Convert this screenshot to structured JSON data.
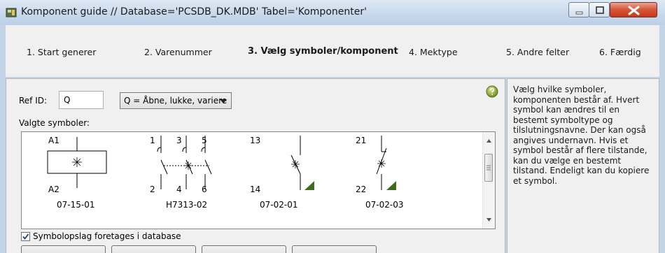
{
  "window": {
    "title": "Komponent guide  //  Database='PCSDB_DK.MDB' Tabel='Komponenter'"
  },
  "steps": [
    {
      "label": "1. Start generer",
      "active": false
    },
    {
      "label": "2. Varenummer",
      "active": false
    },
    {
      "label": "3. Vælg symboler/komponent",
      "active": true
    },
    {
      "label": "4. Mektype",
      "active": false
    },
    {
      "label": "5. Andre felter",
      "active": false
    },
    {
      "label": "6. Færdig",
      "active": false
    }
  ],
  "form": {
    "ref_id_label": "Ref ID:",
    "ref_id_value": "Q",
    "category_selected": "Q = Åbne, lukke, variere",
    "selected_symbols_label": "Valgte symboler:",
    "db_lookup_label": "Symbolopslag foretages i database",
    "db_lookup_checked": true
  },
  "symbols": [
    {
      "name": "07-15-01",
      "pins": [
        "A1",
        "A2"
      ]
    },
    {
      "name": "H7313-02",
      "pins": [
        "1",
        "3",
        "5",
        "2",
        "4",
        "6"
      ]
    },
    {
      "name": "07-02-01",
      "pins": [
        "13",
        "14"
      ]
    },
    {
      "name": "07-02-03",
      "pins": [
        "21",
        "22"
      ]
    }
  ],
  "help_text": "Vælg hvilke symboler, komponenten består af. Hvert symbol kan ændres til en bestemt symboltype og tilslutningsnavne. Der kan også angives undernavn. Hvis et symbol består af flere tilstande, kan du vælge en bestemt tilstand. Endeligt kan du kopiere et symbol.",
  "icons": {
    "app": "app-icon",
    "help": "help-icon",
    "minimize": "minimize-icon",
    "maximize": "maximize-icon",
    "close": "close-icon"
  },
  "colors": {
    "titlebar": "#c8d9ec",
    "close_button": "#c7371a",
    "symbol_line": "#000000",
    "contact_marker": "#3c6e1e",
    "help_icon": "#8aa235"
  }
}
